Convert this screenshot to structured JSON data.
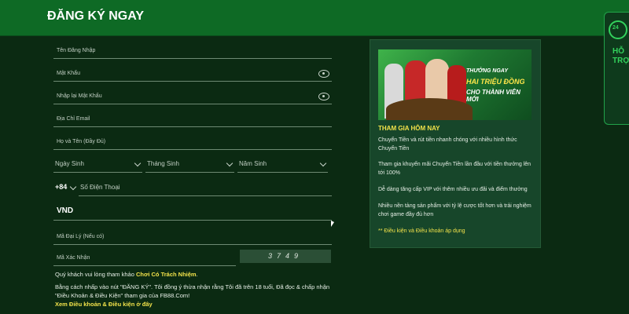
{
  "header": {
    "title": "ĐĂNG KÝ NGAY"
  },
  "form": {
    "username_placeholder": "Tên Đăng Nhập",
    "password_placeholder": "Mật Khẩu",
    "confirm_password_placeholder": "Nhập lại Mật Khẩu",
    "email_placeholder": "Địa Chỉ Email",
    "fullname_placeholder": "Họ và Tên (Đầy Đủ)",
    "dob": {
      "day_placeholder": "Ngày Sinh",
      "month_placeholder": "Tháng Sinh",
      "year_placeholder": "Năm Sinh"
    },
    "phone": {
      "country_code": "+84",
      "placeholder": "Số Điện Thoại"
    },
    "currency_value": "VND",
    "agent_placeholder": "Mã Đại Lý (Nếu có)",
    "captcha_placeholder": "Mã Xác Nhận",
    "captcha_code": "3749"
  },
  "notes": {
    "responsible_prefix": "Quý khách vui lòng tham khảo",
    "responsible_link": "Chơi Có Trách Nhiệm",
    "responsible_suffix": ".",
    "agreement": "Bằng cách nhấp vào nút \"ĐĂNG KÝ\". Tôi đồng ý thừa nhận rằng Tôi đã trên 18 tuổi, Đã đọc & chấp nhận \"Điều Khoản & Điều Kiện\" tham gia của FB88.Com!",
    "terms_link": "Xem Điều khoản & Điều kiện ở đây"
  },
  "promo": {
    "banner_line1": "THƯỞNG NGAY",
    "banner_line2": "HAI TRIỆU ĐỒNG",
    "banner_line3": "CHO THÀNH VIÊN MỚI",
    "title": "THAM GIA HÔM NAY",
    "paragraphs": [
      "Chuyển Tiền và rút tiền nhanh chóng với nhiều hình thức Chuyển Tiền",
      "Tham gia khuyến mãi Chuyển Tiền lần đầu với tiền thưởng lên tới 100%",
      "Dễ dàng tăng cấp VIP với thêm nhiều ưu đãi và điểm thưởng",
      "Nhiều nền tảng sản phẩm với tỷ lệ cược tốt hơn và trải nghiệm chơi game đầy đủ hơn"
    ],
    "terms": "** Điều kiện và Điều khoản áp dụng"
  },
  "support": {
    "label": "HỖ TRỢ"
  },
  "colors": {
    "header": "#0e6a25",
    "background": "#0b2a12",
    "accent_yellow": "#f2e24a",
    "support_green": "#33d15c"
  }
}
